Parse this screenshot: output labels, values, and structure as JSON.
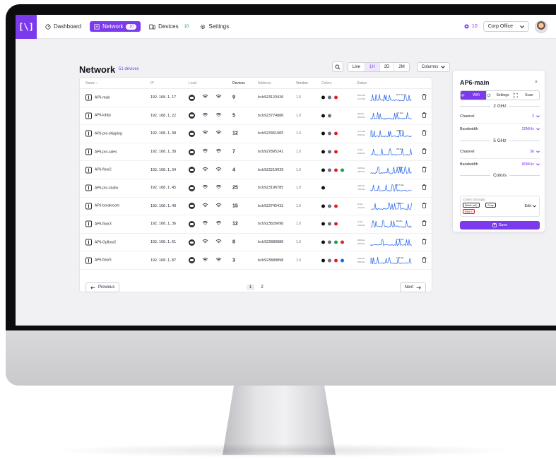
{
  "nav": {
    "logo": "[\\]",
    "items": [
      {
        "label": "Dashboard",
        "icon": "dashboard-icon"
      },
      {
        "label": "Network",
        "icon": "network-icon",
        "badge": "10",
        "active": true
      },
      {
        "label": "Devices",
        "icon": "devices-icon",
        "badge": "10"
      },
      {
        "label": "Settings",
        "icon": "gear-icon"
      }
    ],
    "notif_count": "10",
    "org": "Corp Office",
    "accent": "#7c3aed"
  },
  "page": {
    "title": "Network",
    "count": "51 devices"
  },
  "toolbar": {
    "ranges": [
      "Live",
      "1H",
      "2D",
      "2M"
    ],
    "selected_range": "1H",
    "columns_label": "Columns"
  },
  "table": {
    "headers": {
      "name": "Name ↓",
      "ip": "IP",
      "load": "Load",
      "devices": "Devices",
      "address": "Address",
      "version": "Version",
      "colors": "Colors",
      "status": "Status"
    },
    "rows": [
      {
        "name": "AP6-main",
        "ip": "192.168.1.17",
        "devices": "9",
        "address": "bcb923123426",
        "version": "1.0",
        "colors": [
          "#111111",
          "#6b6e78",
          "#dc2626"
        ],
        "rx": "• 80.8 kb/s",
        "tx": "• 1.47 kb/s",
        "peak": "80.1 kb/s"
      },
      {
        "name": "AP6-lobby",
        "ip": "192.168.1.22",
        "devices": "5",
        "address": "bcb923774886",
        "version": "1.0",
        "colors": [
          "#111111",
          "#6b6e78"
        ],
        "rx": "• 80 kb/s",
        "tx": "• 218 kb/s",
        "peak": "217 kb/s"
      },
      {
        "name": "AP6-pro-shipping",
        "ip": "192.168.1.38",
        "devices": "12",
        "address": "bcb923361965",
        "version": "1.0",
        "colors": [
          "#111111",
          "#6b6e78",
          "#dc2626"
        ],
        "rx": "• 3.72 kb/s",
        "tx": "• 249 kb/s",
        "peak": "256 kb/s"
      },
      {
        "name": "AP6-pro-sales",
        "ip": "192.168.1.38",
        "devices": "7",
        "address": "bcb927895241",
        "version": "1.0",
        "colors": [
          "#111111",
          "#6b6e78",
          "#dc2626"
        ],
        "rx": "• 0 kb/s",
        "tx": "• 249 kb/s",
        "peak": "248 kb/s"
      },
      {
        "name": "AP6-floor2",
        "ip": "192.168.1.34",
        "devices": "4",
        "address": "bcb923219939",
        "version": "1.0",
        "colors": [
          "#111111",
          "#6b6e78",
          "#dc2626",
          "#16a34a"
        ],
        "rx": "• 728 kb/s",
        "tx": "• 250 kb/s",
        "peak": "700 kb/s"
      },
      {
        "name": "AP6-pro-studio",
        "ip": "192.168.1.45",
        "devices": "25",
        "address": "bcb923196785",
        "version": "1.0",
        "colors": [
          "#111111"
        ],
        "rx": "• 400 kb/s",
        "tx": "• 726 kb/s",
        "peak": "50.7 kb/s"
      },
      {
        "name": "AP6-breakroom",
        "ip": "192.168.1.48",
        "devices": "15",
        "address": "bcb923745432",
        "version": "1.0",
        "colors": [
          "#111111",
          "#6b6e78",
          "#dc2626"
        ],
        "rx": "• 0 kb/s",
        "tx": "• 121 kb/s",
        "peak": "540 kb/s"
      },
      {
        "name": "AP6-floor3",
        "ip": "192.168.1.36",
        "devices": "12",
        "address": "bcb923826698",
        "version": "1.0",
        "colors": [
          "#111111",
          "#6b6e78",
          "#dc2626"
        ],
        "rx": "• 0 kb/s",
        "tx": "• 135 kb/s",
        "peak": "80 kb/s"
      },
      {
        "name": "AP6-Opfloor2",
        "ip": "192.168.1.61",
        "devices": "8",
        "address": "bcb923880886",
        "version": "1.0",
        "colors": [
          "#111111",
          "#6b6e78",
          "#16a34a",
          "#dc2626"
        ],
        "rx": "• 800 kb/s",
        "tx": "• 354 kb/s",
        "peak": "30.6 kb/s"
      },
      {
        "name": "AP6-floor5",
        "ip": "192.168.1.87",
        "devices": "3",
        "address": "bcb923880898",
        "version": "1.0",
        "colors": [
          "#111111",
          "#6b6e78",
          "#dc2626",
          "#2563eb"
        ],
        "rx": "• 204 kb/s",
        "tx": "• 200 kb/s",
        "peak": "0.33 kb/s"
      }
    ],
    "pagination": {
      "prev": "Previous",
      "next": "Next",
      "pages": [
        "1",
        "2"
      ],
      "current": "1"
    }
  },
  "panel": {
    "title": "AP6-main",
    "close": "×",
    "tabs": [
      "WiFi",
      "Settings",
      "Scan"
    ],
    "selected_tab": "WiFi",
    "band_24": "2 GHz",
    "band_5": "5 GHz",
    "channel_label": "Channel",
    "bandwidth_label": "Bandwidth",
    "ch_24": "2",
    "bw_24": "20MHz",
    "ch_5": "36",
    "bw_5": "80MHz",
    "colors_heading": "Colors",
    "groups_label": "Colors (Groups)",
    "chips": [
      "Black (all)",
      "Gray",
      "Red"
    ],
    "edit_label": "Edit",
    "save_label": "Save"
  }
}
